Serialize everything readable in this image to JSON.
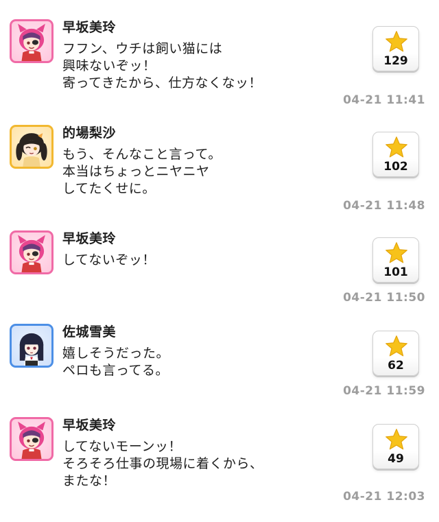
{
  "posts": [
    {
      "name": "早坂美玲",
      "lines": [
        "フフン、ウチは飼い猫には",
        "興味ないぞッ！",
        "寄ってきたから、仕方なくなッ！"
      ],
      "likes": "129",
      "time": "04-21 11:41",
      "avatar_type": "cute"
    },
    {
      "name": "的場梨沙",
      "lines": [
        "もう、そんなこと言って。",
        "本当はちょっとニヤニヤ",
        "してたくせに。"
      ],
      "likes": "102",
      "time": "04-21 11:48",
      "avatar_type": "passion"
    },
    {
      "name": "早坂美玲",
      "lines": [
        "してないぞッ！"
      ],
      "likes": "101",
      "time": "04-21 11:50",
      "avatar_type": "cute"
    },
    {
      "name": "佐城雪美",
      "lines": [
        "嬉しそうだった。",
        "ペロも言ってる。"
      ],
      "likes": "62",
      "time": "04-21 11:59",
      "avatar_type": "cool"
    },
    {
      "name": "早坂美玲",
      "lines": [
        "してないモーンッ！",
        "そろそろ仕事の現場に着くから、",
        "またな！"
      ],
      "likes": "49",
      "time": "04-21 12:03",
      "avatar_type": "cute"
    }
  ],
  "icons": {
    "like": "star-icon"
  },
  "colors": {
    "star": "#f7c21a",
    "timestamp": "#9d9d9d",
    "cute_frame": "#f06aa6",
    "passion_frame": "#f2b830",
    "cool_frame": "#4c8fe6"
  }
}
